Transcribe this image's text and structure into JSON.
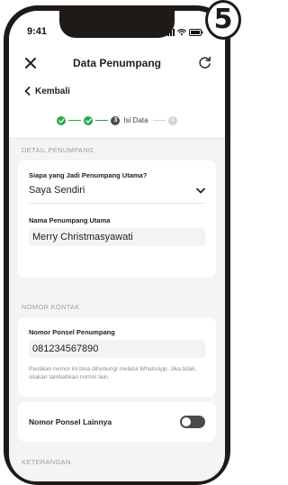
{
  "badge": {
    "number": "5"
  },
  "status_bar": {
    "time": "9:41"
  },
  "nav": {
    "title": "Data Penumpang"
  },
  "back": {
    "label": "Kembali"
  },
  "stepper": {
    "current_step_number": "3",
    "current_step_label": "Isi Data",
    "next_step_number": "4"
  },
  "sections": {
    "passenger_detail": "DETAIL PENUMPANG",
    "contact": "NOMOR KONTAK",
    "notes": "KETERANGAN"
  },
  "passenger_card": {
    "main_passenger_question": "Siapa yang Jadi Penumpang Utama?",
    "main_passenger_selected": "Saya Sendiri",
    "main_passenger_name_label": "Nama Penumpang Utama",
    "main_passenger_name_value": "Merry Christmasyawati"
  },
  "contact_card": {
    "phone_label": "Nomor Ponsel Penumpang",
    "phone_value": "081234567890",
    "helper_text": "Pastikan nomor ini bisa dihubungi melalui WhatsApp. Jika tidak, silakan tambahkan nomor lain."
  },
  "other_phone": {
    "label": "Nomor Ponsel Lainnya",
    "toggle_on": false
  },
  "colors": {
    "accent_green": "#2aa84a",
    "frame": "#1f1a17",
    "background": "#f4f4f4"
  }
}
